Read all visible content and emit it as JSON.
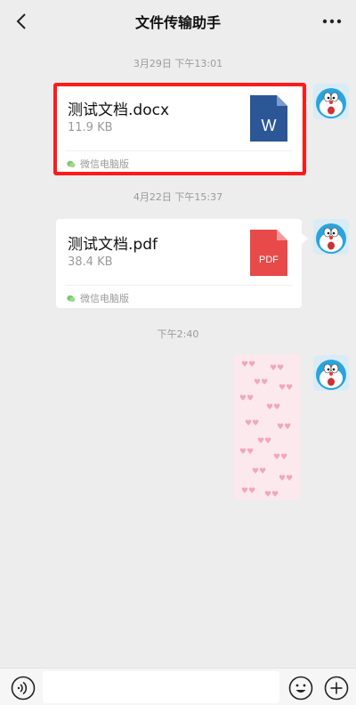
{
  "header": {
    "title": "文件传输助手"
  },
  "timestamps": [
    "3月29日 下午13:01",
    "4月22日 下午15:37",
    "下午2:40"
  ],
  "messages": [
    {
      "file_name": "测试文档.docx",
      "file_size": "11.9 KB",
      "source": "微信电脑版",
      "icon_label": "W",
      "icon_color": "#2b5797",
      "highlighted": true
    },
    {
      "file_name": "测试文档.pdf",
      "file_size": "38.4 KB",
      "source": "微信电脑版",
      "icon_label": "PDF",
      "icon_color": "#e84a4a",
      "highlighted": false
    }
  ],
  "input": {
    "placeholder": ""
  },
  "colors": {
    "background": "#ededed",
    "highlight": "#ff1a1a",
    "source_icon": "#7bc96f"
  }
}
